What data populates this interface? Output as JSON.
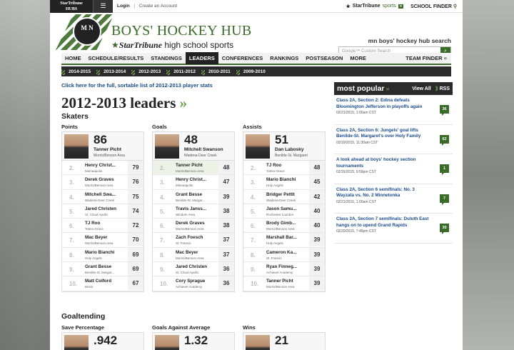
{
  "topbar": {
    "logo_line1": "StarTribune",
    "logo_line2": "HUBS",
    "menu_glyph": "☰",
    "login": "Login",
    "create_account": "Create an Account",
    "brand": "StarTribune",
    "brand_section": "sports",
    "school_finder": "SCHOOL FINDER"
  },
  "masthead": {
    "title": "BOYS' HOCKEY HUB",
    "brand": "StarTribune",
    "subtitle": "high school sports",
    "search_label": "mn boys' hockey hub search",
    "search_placeholder": "Google™ Custom Search",
    "logo_text": "M N"
  },
  "nav": {
    "items": [
      "HOME",
      "SCHEDULE/RESULTS",
      "STANDINGS",
      "LEADERS",
      "CONFERENCES",
      "RANKINGS",
      "POSTSEASON",
      "MORE"
    ],
    "active": "LEADERS",
    "team_finder": "TEAM FINDER"
  },
  "seasons": [
    "2014-2015",
    "2013-2014",
    "2012-2013",
    "2011-2012",
    "2010-2011",
    "2009-2010"
  ],
  "full_list_link": "Click here for the full, sortable list of 2012-2013 player stats",
  "heading": "2012-2013 leaders",
  "heading_arrows": "»",
  "skaters_heading": "Skaters",
  "goaltending_heading": "Goaltending",
  "categories": {
    "points": {
      "label": "Points",
      "leader": {
        "value": "86",
        "name": "Tanner Picht",
        "school": "Morris/Benson Area"
      },
      "rows": [
        {
          "rank": "2.",
          "name": "Henry Christ...",
          "school": "Minneapolis",
          "value": "79"
        },
        {
          "rank": "3.",
          "name": "Derek Graves",
          "school": "Morris/Benson Area",
          "value": "76"
        },
        {
          "rank": "4.",
          "name": "Mitchell Swa...",
          "school": "Wadena-Deer Creek",
          "value": "75"
        },
        {
          "rank": "5.",
          "name": "Jared Christen",
          "school": "St. Cloud Apollo",
          "value": "74"
        },
        {
          "rank": "6.",
          "name": "TJ Roo",
          "school": "Totino-Grace",
          "value": "72"
        },
        {
          "rank": "7.",
          "name": "Mac Beyer",
          "school": "Morris/Benson Area",
          "value": "70"
        },
        {
          "rank": "8.",
          "name": "Mario Bianchi",
          "school": "Holy Angels",
          "value": "69"
        },
        {
          "rank": "9.",
          "name": "Grant Besse",
          "school": "Benilde-St. Margar...",
          "value": "69"
        },
        {
          "rank": "10.",
          "name": "Matt Colford",
          "school": "Breck",
          "value": "67"
        }
      ]
    },
    "goals": {
      "label": "Goals",
      "leader": {
        "value": "48",
        "name": "Mitchell Swanson",
        "school": "Wadena-Deer Creek"
      },
      "rows": [
        {
          "rank": "2.",
          "name": "Tanner Picht",
          "school": "Morris/Benson Area",
          "value": "48"
        },
        {
          "rank": "3.",
          "name": "Henry Christ...",
          "school": "Minneapolis",
          "value": "47"
        },
        {
          "rank": "4.",
          "name": "Grant Besse",
          "school": "Benilde-St. Margar...",
          "value": "39"
        },
        {
          "rank": "5.",
          "name": "Travis Janss...",
          "school": "Windom Area",
          "value": "38"
        },
        {
          "rank": "6.",
          "name": "Derek Graves",
          "school": "Morris/Benson Area",
          "value": "38"
        },
        {
          "rank": "7.",
          "name": "Zach Foesch",
          "school": "St. Francis",
          "value": "37"
        },
        {
          "rank": "8.",
          "name": "Mac Beyer",
          "school": "Morris/Benson Area",
          "value": "37"
        },
        {
          "rank": "9.",
          "name": "Jared Christen",
          "school": "St. Cloud Apollo",
          "value": "36"
        },
        {
          "rank": "10.",
          "name": "Cory Sprague",
          "school": "Achiever Academy",
          "value": "36"
        }
      ]
    },
    "assists": {
      "label": "Assists",
      "leader": {
        "value": "51",
        "name": "Dan Labosky",
        "school": "Benilde-St. Margaret"
      },
      "rows": [
        {
          "rank": "2.",
          "name": "TJ Roo",
          "school": "Totino-Grace",
          "value": "48"
        },
        {
          "rank": "3.",
          "name": "Mario Bianchi",
          "school": "Holy Angels",
          "value": "45"
        },
        {
          "rank": "4.",
          "name": "Bridger Pettit",
          "school": "Wadena-Deer Creek",
          "value": "42"
        },
        {
          "rank": "5.",
          "name": "Jason Samu...",
          "school": "Rochester Lourdes",
          "value": "40"
        },
        {
          "rank": "6.",
          "name": "Brody Gimb...",
          "school": "Morris/Benson Area",
          "value": "40"
        },
        {
          "rank": "7.",
          "name": "Marshall Bar...",
          "school": "Holy Angels",
          "value": "39"
        },
        {
          "rank": "8.",
          "name": "Cameron Ka...",
          "school": "St. Francis",
          "value": "39"
        },
        {
          "rank": "9.",
          "name": "Ryan Finneg...",
          "school": "Achiever Academy",
          "value": "39"
        },
        {
          "rank": "10.",
          "name": "Tanner Picht",
          "school": "Morris/Benson Area",
          "value": "39"
        }
      ]
    }
  },
  "goaltending": {
    "save_pct": {
      "label": "Save Percentage",
      "value": ".942"
    },
    "gaa": {
      "label": "Goals Against Average",
      "value": "1.32"
    },
    "wins": {
      "label": "Wins",
      "value": "21"
    }
  },
  "most_popular": {
    "title": "most popular",
    "arrows": "»",
    "view_all": "View All",
    "rss": "RSS",
    "items": [
      {
        "title": "Class 2A, Section 2: Edina defeats Bloomington Jefferson in playoffs again",
        "date": "02/21/2015, 1:00am CST",
        "count": "36"
      },
      {
        "title": "Class 2A, Section 6: Jungels' goal lifts Benilde-St. Margaret's over Holy Family",
        "date": "02/19/2015, 11:30am CST",
        "count": "62"
      },
      {
        "title": "A look ahead at boys' hockey section tournaments",
        "date": "02/16/2015, 9:59pm CST",
        "count": "1"
      },
      {
        "title": "Class 2A, Section 6 semifinals: No. 3 Wayzata vs. No. 2 Minnetonka",
        "date": "02/21/2015, 1:00am CST",
        "count": "7"
      },
      {
        "title": "Class 2A, Section 7 semifinals: Duluth East hangs on to upend Grand Rapids",
        "date": "02/20/2015, 7:45pm CST",
        "count": "30"
      }
    ]
  }
}
